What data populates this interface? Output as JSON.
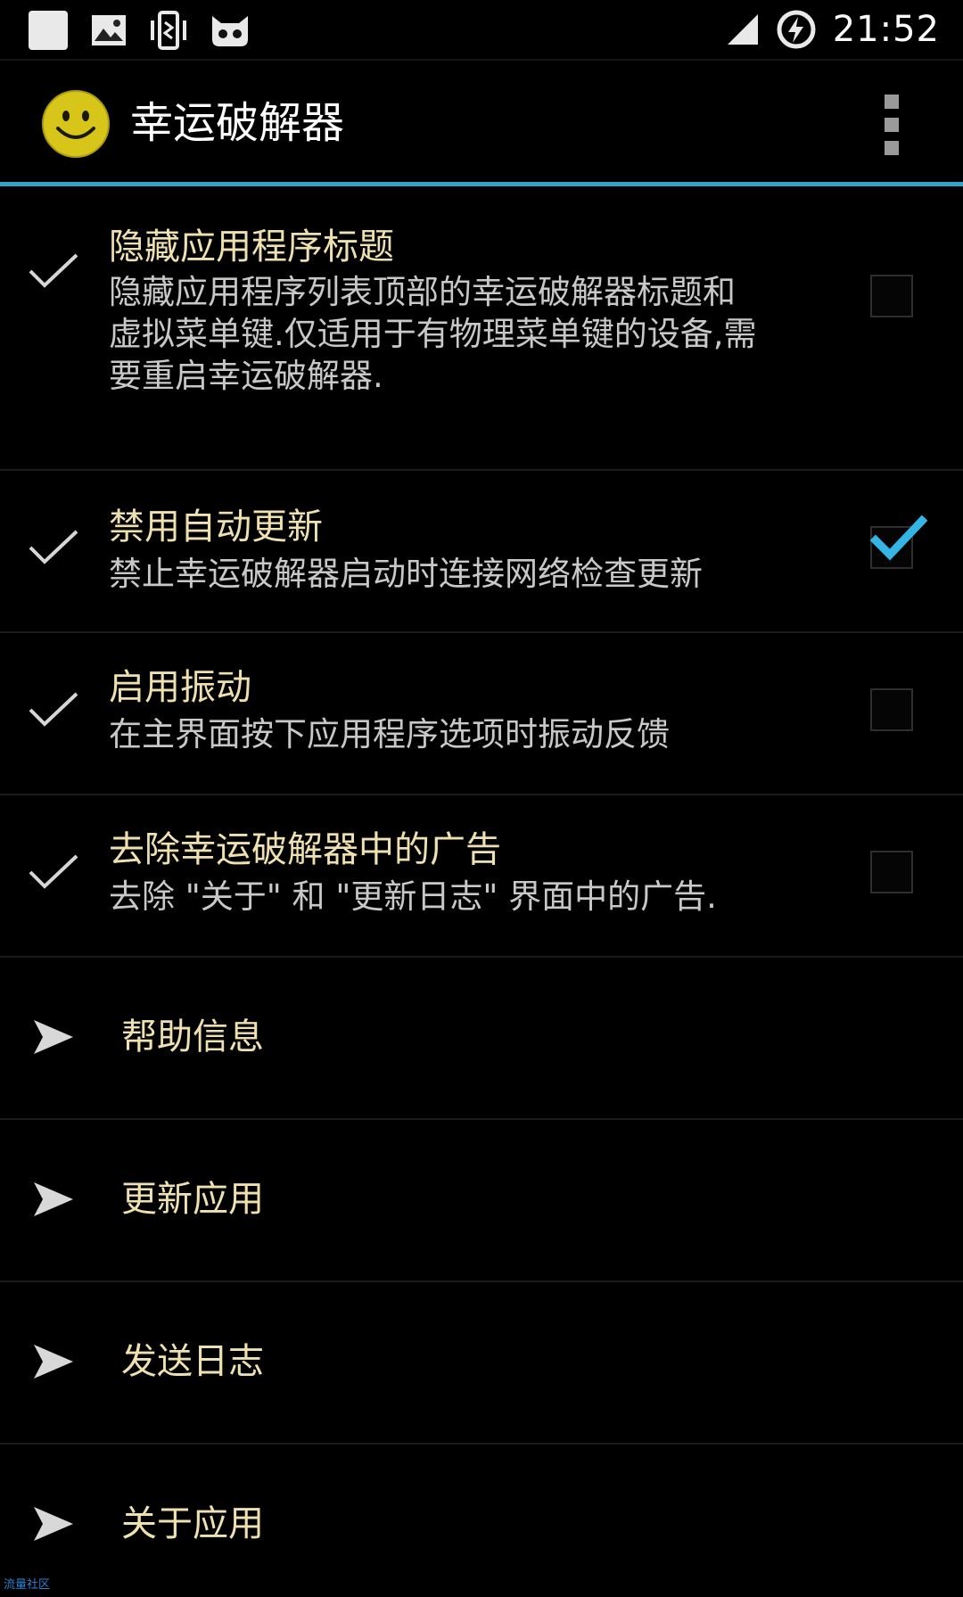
{
  "status_bar": {
    "time": "21:52",
    "icons": [
      "notification-square-icon",
      "image-icon",
      "vibrate-icon",
      "cat-face-icon",
      "signal-icon",
      "charging-icon"
    ]
  },
  "action_bar": {
    "title": "幸运破解器",
    "logo": "smiley-face-logo",
    "menu_icon": "overflow-menu-icon"
  },
  "colors": {
    "accent": "#34a5c9",
    "title_text": "#efe0b0",
    "summary_text": "#c8c8c8",
    "background": "#000000"
  },
  "preferences": [
    {
      "title": "隐藏应用程序标题",
      "summary_lines": [
        "隐藏应用程序列表顶部的幸运破解器标题和",
        "虚拟菜单键.仅适用于有物理菜单键的设备,需",
        "要重启幸运破解器."
      ],
      "checked": false
    },
    {
      "title": "禁用自动更新",
      "summary_lines": [
        "禁止幸运破解器启动时连接网络检查更新"
      ],
      "checked": true
    },
    {
      "title": "启用振动",
      "summary_lines": [
        "在主界面按下应用程序选项时振动反馈"
      ],
      "checked": false
    },
    {
      "title": "去除幸运破解器中的广告",
      "summary_lines": [
        "去除 \"关于\" 和 \"更新日志\" 界面中的广告."
      ],
      "checked": false
    }
  ],
  "actions": [
    {
      "label": "帮助信息",
      "icon": "send-arrow-icon"
    },
    {
      "label": "更新应用",
      "icon": "send-arrow-icon"
    },
    {
      "label": "发送日志",
      "icon": "send-arrow-icon"
    },
    {
      "label": "关于应用",
      "icon": "send-arrow-icon"
    }
  ],
  "watermark": "流量社区"
}
